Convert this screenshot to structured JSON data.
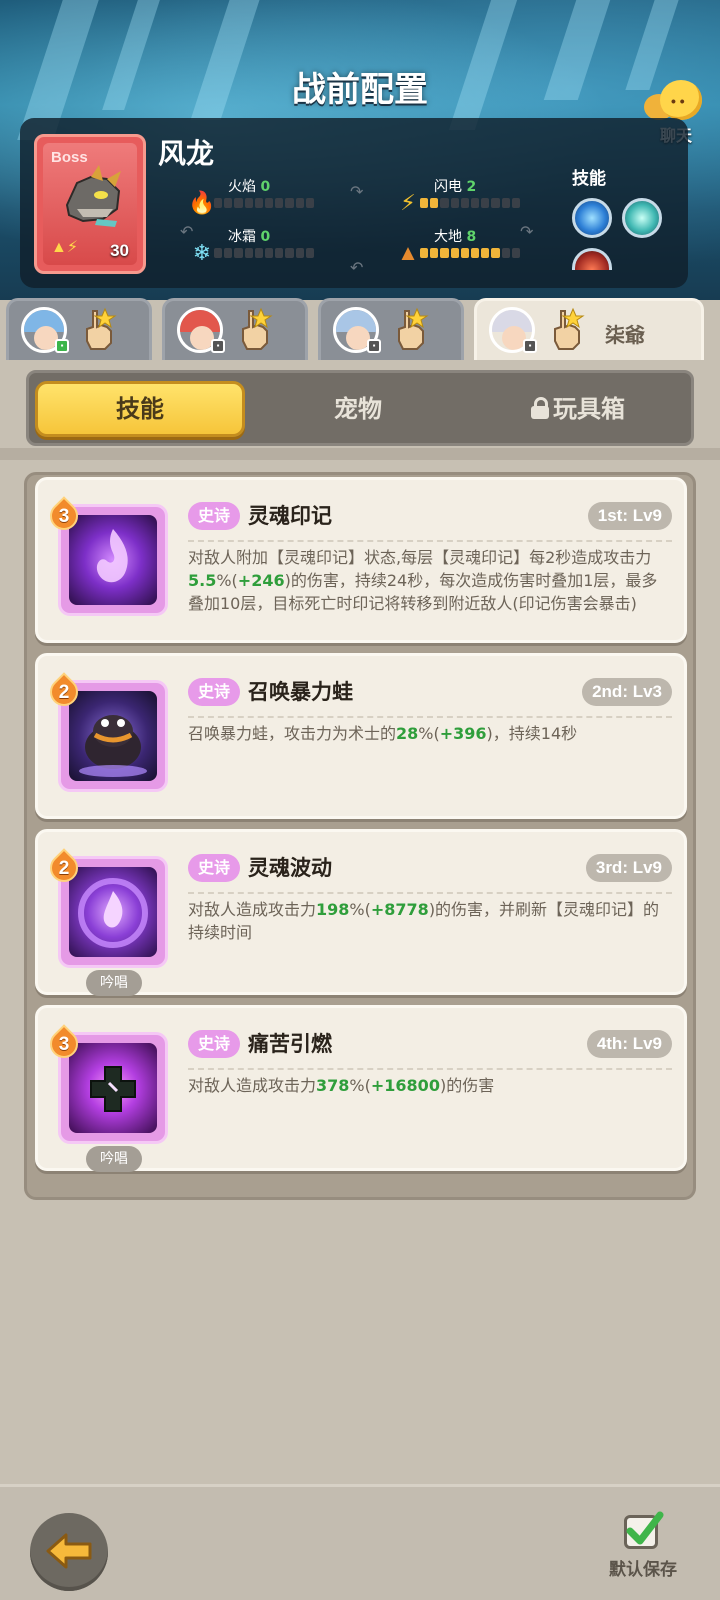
{
  "title": "战前配置",
  "chat": {
    "label": "聊天"
  },
  "boss": {
    "tag": "Boss",
    "name": "风龙",
    "level": "30",
    "skills_label": "技能",
    "stats": [
      {
        "label": "火焰",
        "value": "0",
        "fill": 0,
        "icon": "fire-icon"
      },
      {
        "label": "闪电",
        "value": "2",
        "fill": 2,
        "icon": "lightning-icon"
      },
      {
        "label": "冰霜",
        "value": "0",
        "fill": 0,
        "icon": "snowflake-icon"
      },
      {
        "label": "大地",
        "value": "8",
        "fill": 8,
        "icon": "mountain-icon"
      }
    ]
  },
  "hero_tabs": [
    {
      "name": "",
      "active": false,
      "hair": "#7fb6e6",
      "badge_color": "#3cb54a"
    },
    {
      "name": "",
      "active": false,
      "hair": "#e2574c",
      "badge_color": "#555555"
    },
    {
      "name": "",
      "active": false,
      "hair": "#a9c6e6",
      "badge_color": "#555555"
    },
    {
      "name": "柒爺",
      "active": true,
      "hair": "#d9d9e6",
      "badge_color": "#555555"
    }
  ],
  "section_tabs": {
    "skills": "技能",
    "pets": "宠物",
    "toybox": "玩具箱"
  },
  "skills": [
    {
      "rank": "3",
      "rarity": "史诗",
      "name": "灵魂印记",
      "slot": "1st: Lv9",
      "chant": "",
      "desc_parts": [
        {
          "t": "对敌人附加【灵魂印记】状态,每层【灵魂印记】每2秒造成攻击力"
        },
        {
          "t": "5.5",
          "g": true
        },
        {
          "t": "%("
        },
        {
          "t": "+246",
          "g": true
        },
        {
          "t": ")的伤害，持续24秒，每次造成伤害时叠加1层，最多叠加10层，目标死亡时印记将转移到附近敌人(印记伤害会暴击)"
        }
      ]
    },
    {
      "rank": "2",
      "rarity": "史诗",
      "name": "召唤暴力蛙",
      "slot": "2nd: Lv3",
      "chant": "",
      "desc_parts": [
        {
          "t": "召唤暴力蛙，攻击力为术士的"
        },
        {
          "t": "28",
          "g": true
        },
        {
          "t": "%("
        },
        {
          "t": "+396",
          "g": true
        },
        {
          "t": ")，持续14秒"
        }
      ]
    },
    {
      "rank": "2",
      "rarity": "史诗",
      "name": "灵魂波动",
      "slot": "3rd: Lv9",
      "chant": "吟唱",
      "desc_parts": [
        {
          "t": "对敌人造成攻击力"
        },
        {
          "t": "198",
          "g": true
        },
        {
          "t": "%("
        },
        {
          "t": "+8778",
          "g": true
        },
        {
          "t": ")的伤害，并刷新【灵魂印记】的持续时间"
        }
      ]
    },
    {
      "rank": "3",
      "rarity": "史诗",
      "name": "痛苦引燃",
      "slot": "4th: Lv9",
      "chant": "吟唱",
      "desc_parts": [
        {
          "t": "对敌人造成攻击力"
        },
        {
          "t": "378",
          "g": true
        },
        {
          "t": "%("
        },
        {
          "t": "+16800",
          "g": true
        },
        {
          "t": ")的伤害"
        }
      ]
    }
  ],
  "footer": {
    "save_label": "默认保存"
  }
}
